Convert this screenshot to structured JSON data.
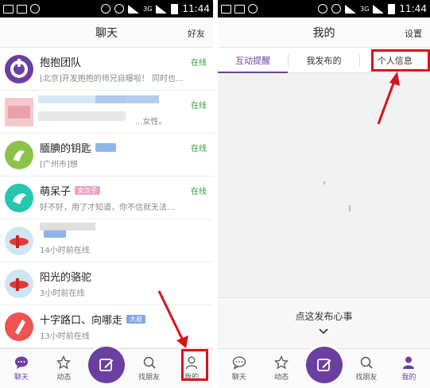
{
  "status_bar": {
    "left": {
      "time": "11:44",
      "network": "3G"
    },
    "right": {
      "time": "11:44",
      "network": "3G"
    }
  },
  "left_screen": {
    "header": {
      "title": "聊天",
      "action": "好友"
    },
    "chats": [
      {
        "name": "抱抱团队",
        "preview": "[北京]开发抱抱的师兄自曝啦！ 同时也...",
        "status": "在线",
        "tag": "",
        "tag_color": "",
        "avatar_color": "#6b3fa0"
      },
      {
        "name": "",
        "preview": "...女性。",
        "status": "在线",
        "tag": "",
        "tag_color": "",
        "avatar_color": "#f3c9cf"
      },
      {
        "name": "腼腆的钥匙",
        "preview": "[广州市]想",
        "status": "在线",
        "tag": "",
        "tag_color": "#8fb5e8",
        "avatar_color": "#8bc34a"
      },
      {
        "name": "萌呆子",
        "preview": "好不好，用了才知道，你不信就无法...",
        "status": "在线",
        "tag": "女汉子",
        "tag_color": "#e9a6c6",
        "avatar_color": "#26c6b0"
      },
      {
        "name": "",
        "preview": "14小时前在线",
        "status": "",
        "tag": "",
        "tag_color": "#8fb5e8",
        "avatar_color": "#cfe6f2"
      },
      {
        "name": "阳光的骆驼",
        "preview": "3小时前在线",
        "status": "",
        "tag": "",
        "tag_color": "",
        "avatar_color": "#cfe6f2"
      },
      {
        "name": "十字路口、向哪走",
        "preview": "13小时前在线",
        "status": "",
        "tag": "大叔",
        "tag_color": "#7fa6e6",
        "avatar_color": "#ef5350"
      }
    ],
    "tabs": [
      {
        "label": "聊天",
        "icon": "chat-bubble-icon",
        "active": true
      },
      {
        "label": "动态",
        "icon": "star-icon",
        "active": false
      },
      {
        "label": "",
        "icon": "compose-icon",
        "active": false
      },
      {
        "label": "找朋友",
        "icon": "search-icon",
        "active": false
      },
      {
        "label": "我的",
        "icon": "person-icon",
        "active": false
      }
    ]
  },
  "right_screen": {
    "header": {
      "title": "我的",
      "action": "设置"
    },
    "segments": [
      {
        "label": "互动提醒",
        "active": true
      },
      {
        "label": "我发布的",
        "active": false
      },
      {
        "label": "个人信息",
        "active": false
      }
    ],
    "publish_prompt": "点这发布心事",
    "tabs": [
      {
        "label": "聊天",
        "icon": "chat-bubble-icon",
        "active": false
      },
      {
        "label": "动态",
        "icon": "star-icon",
        "active": false
      },
      {
        "label": "",
        "icon": "compose-icon",
        "active": false
      },
      {
        "label": "找朋友",
        "icon": "search-icon",
        "active": false
      },
      {
        "label": "我的",
        "icon": "person-icon",
        "active": true
      }
    ]
  },
  "colors": {
    "accent": "#6b3fa0",
    "online": "#2f9e3a",
    "highlight": "#d8141a"
  }
}
